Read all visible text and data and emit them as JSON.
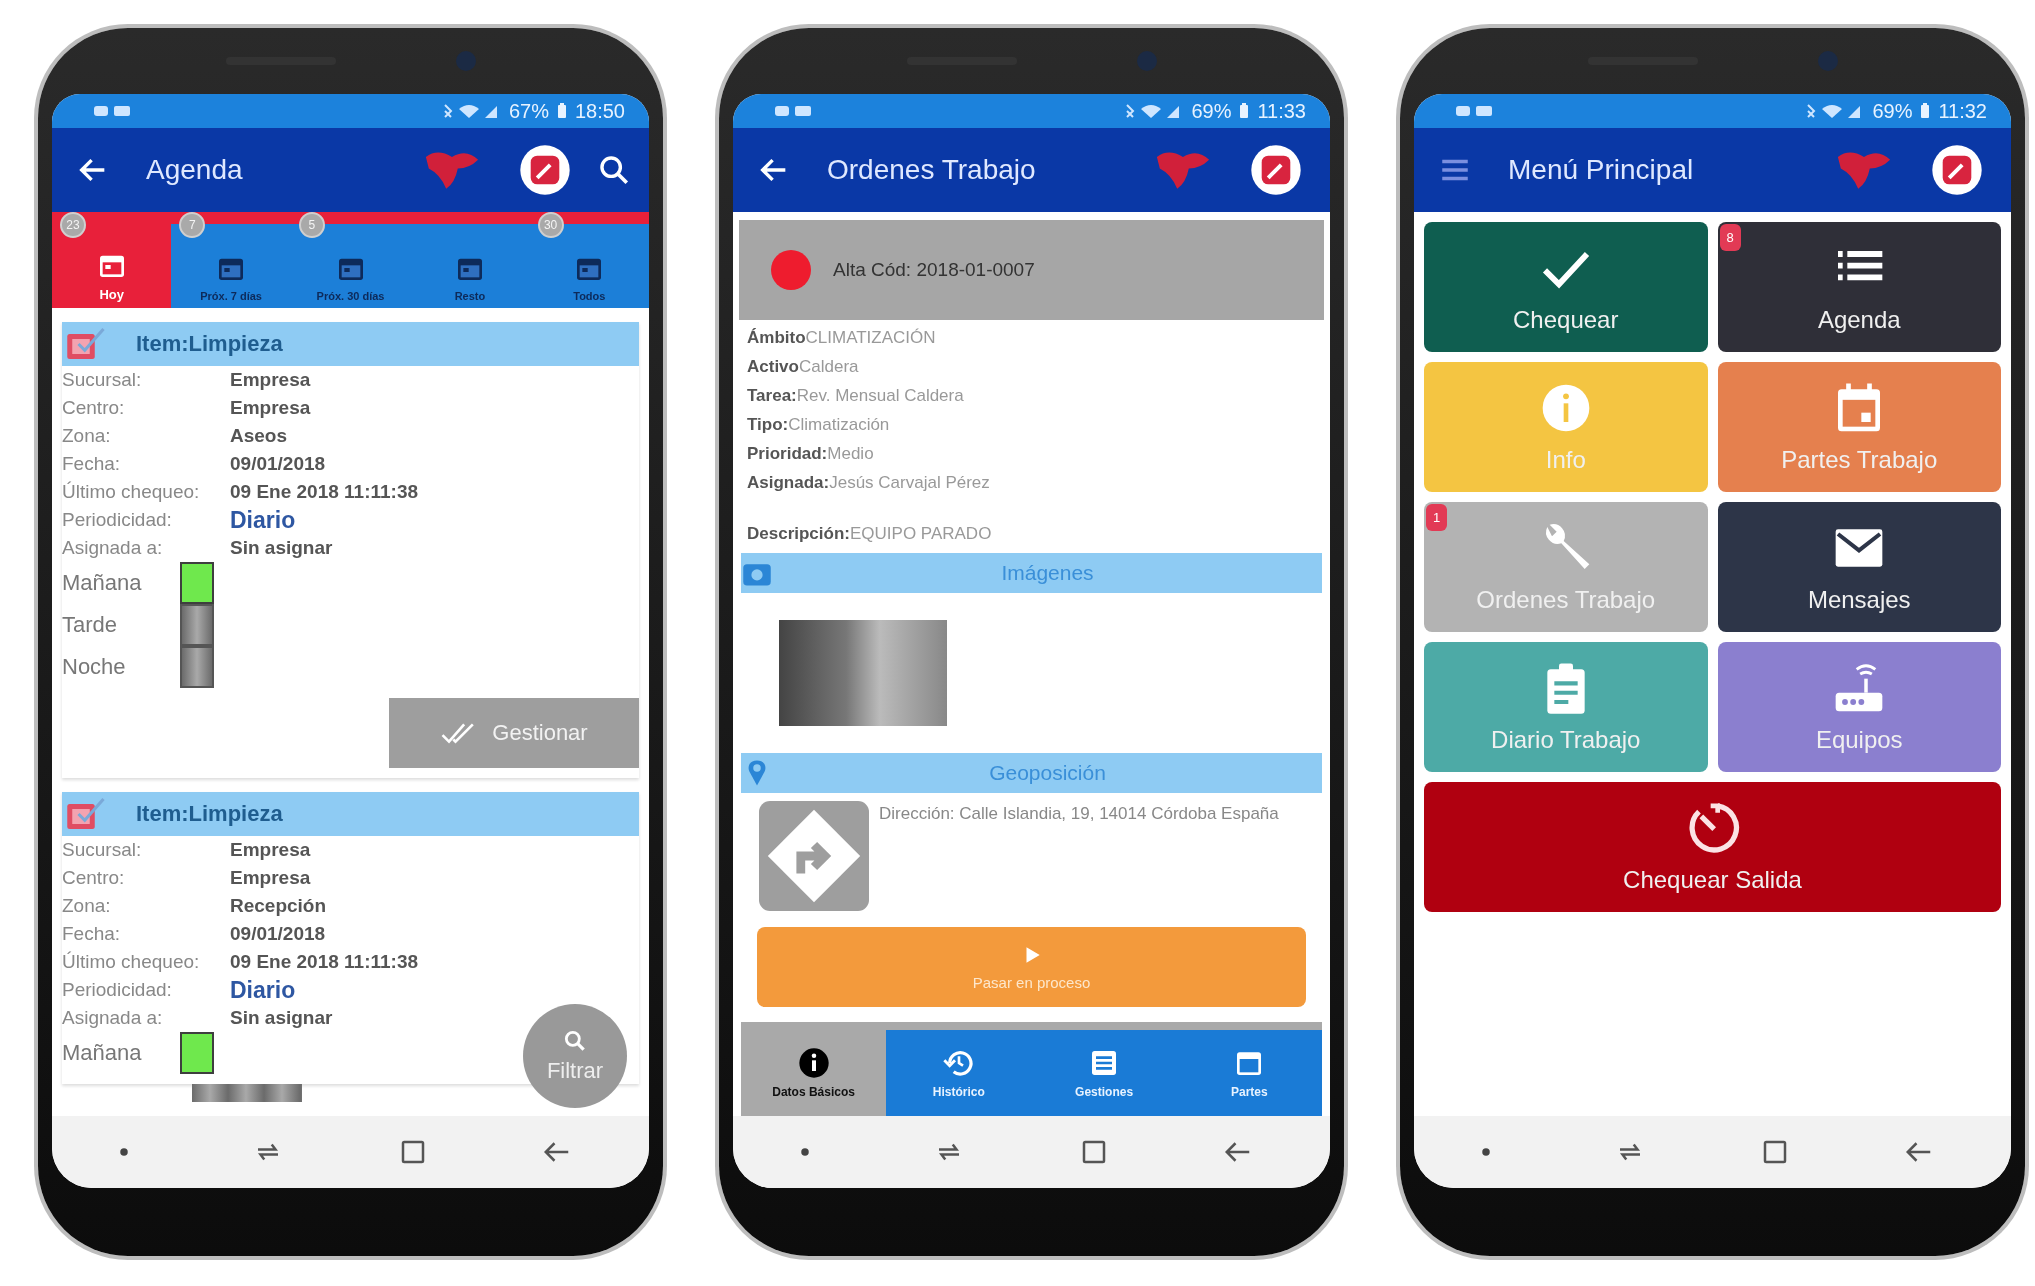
{
  "phones": [
    {
      "kind": "agenda",
      "status_bar": {
        "battery": "67%",
        "time": "18:50"
      },
      "app_bar": {
        "kind": "back",
        "title": "Agenda",
        "search": true
      },
      "tabs": [
        {
          "label": "Hoy",
          "count": "23",
          "selected": true
        },
        {
          "label": "Próx. 7 días",
          "count": "7",
          "selected": false
        },
        {
          "label": "Próx. 30 días",
          "count": "5",
          "selected": false
        },
        {
          "label": "Resto",
          "selected": false
        },
        {
          "label": "Todos",
          "count": "30",
          "selected": false
        }
      ],
      "cards": [
        {
          "title": "Item:Limpieza",
          "fields": [
            {
              "label": "Sucursal:",
              "value": "Empresa",
              "highlight": false
            },
            {
              "label": "Centro:",
              "value": "Empresa",
              "highlight": false
            },
            {
              "label": "Zona:",
              "value": "Aseos",
              "highlight": false
            },
            {
              "label": "Fecha:",
              "value": "09/01/2018",
              "highlight": false
            },
            {
              "label": "Último chequeo:",
              "value": "09 Ene 2018 11:11:38",
              "highlight": false
            },
            {
              "label": "Periodicidad:",
              "value": "Diario",
              "highlight": true
            },
            {
              "label": "Asignada a:",
              "value": "Sin asignar",
              "highlight": false
            }
          ],
          "shifts": [
            {
              "label": "Mañana",
              "on": true
            },
            {
              "label": "Tarde",
              "on": false
            },
            {
              "label": "Noche",
              "on": false
            }
          ],
          "button": "Gestionar"
        },
        {
          "title": "Item:Limpieza",
          "fields": [
            {
              "label": "Sucursal:",
              "value": "Empresa",
              "highlight": false
            },
            {
              "label": "Centro:",
              "value": "Empresa",
              "highlight": false
            },
            {
              "label": "Zona:",
              "value": "Recepción",
              "highlight": false
            },
            {
              "label": "Fecha:",
              "value": "09/01/2018",
              "highlight": false
            },
            {
              "label": "Último chequeo:",
              "value": "09 Ene 2018 11:11:38",
              "highlight": false
            },
            {
              "label": "Periodicidad:",
              "value": "Diario",
              "highlight": true
            },
            {
              "label": "Asignada a:",
              "value": "Sin asignar",
              "highlight": false
            }
          ],
          "shifts": [
            {
              "label": "Mañana",
              "on": true
            }
          ]
        }
      ],
      "fab": "Filtrar"
    },
    {
      "kind": "order",
      "status_bar": {
        "battery": "69%",
        "time": "11:33"
      },
      "app_bar": {
        "kind": "back",
        "title": "Ordenes Trabajo"
      },
      "header": {
        "color": "#ee1c2e",
        "text": "Alta Cód: 2018-01-0007"
      },
      "lines": [
        "**Ámbito**CLIMATIZACIÓN",
        "**Activo**Caldera",
        "**Tarea:**Rev. Mensual Caldera",
        "**Tipo:**Climatización",
        "**Prioridad:**Medio",
        "**Asignada:**Jesús Carvajal Pérez"
      ],
      "description": "**Descripción:**EQUIPO PARADO",
      "images_title": "Imágenes",
      "geo_title": "Geoposición",
      "address": "Dirección: Calle Islandia, 19, 14014 Córdoba España",
      "action": "Pasar en proceso",
      "bottom_tabs": [
        {
          "label": "Datos Básicos",
          "selected": true
        },
        {
          "label": "Histórico",
          "selected": false
        },
        {
          "label": "Gestiones",
          "selected": false
        },
        {
          "label": "Partes",
          "selected": false
        }
      ]
    },
    {
      "kind": "menu",
      "status_bar": {
        "battery": "69%",
        "time": "11:32"
      },
      "app_bar": {
        "kind": "menu",
        "title": "Menú Principal"
      },
      "tiles": [
        {
          "label": "Chequear",
          "color": "#0f5e50"
        },
        {
          "label": "Agenda",
          "color": "#2f2f38",
          "badge": "8"
        },
        {
          "label": "Info",
          "color": "#f4c542"
        },
        {
          "label": "Partes Trabajo",
          "color": "#e5804e"
        },
        {
          "label": "Ordenes Trabajo",
          "color": "#b3b3b3",
          "badge": "1"
        },
        {
          "label": "Mensajes",
          "color": "#2d3548"
        },
        {
          "label": "Diario Trabajo",
          "color": "#4daaa6"
        },
        {
          "label": "Equipos",
          "color": "#8b7fcf"
        },
        {
          "label": "Chequear Salida",
          "color": "#b00010",
          "wide": true
        }
      ]
    }
  ]
}
